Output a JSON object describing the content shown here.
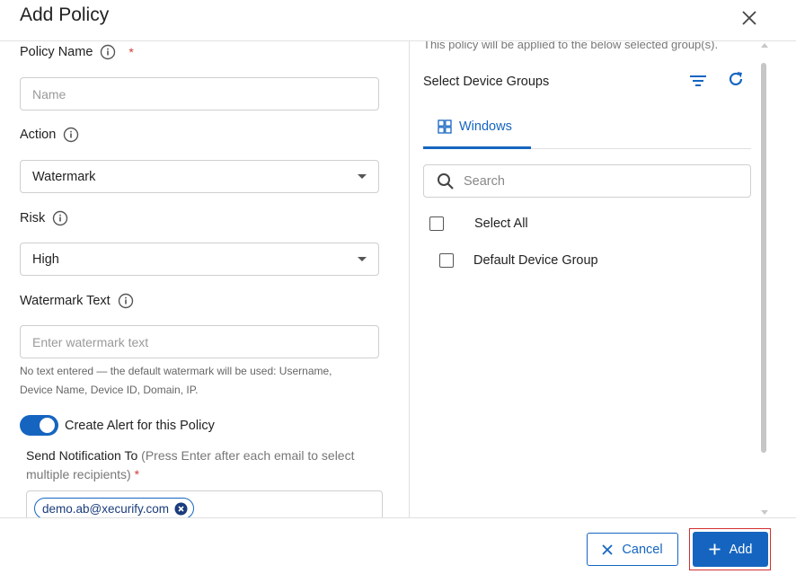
{
  "dialog": {
    "title": "Add Policy"
  },
  "form": {
    "policy_name": {
      "label": "Policy Name",
      "required_mark": "*",
      "placeholder": "Name",
      "value": ""
    },
    "action": {
      "label": "Action",
      "value": "Watermark"
    },
    "risk": {
      "label": "Risk",
      "value": "High"
    },
    "watermark_text": {
      "label": "Watermark Text",
      "placeholder": "Enter watermark text",
      "value": "",
      "helper_line1": "No text entered — the default watermark will be used: Username,",
      "helper_line2": "Device Name, Device ID, Domain, IP."
    },
    "alert_toggle": {
      "label": "Create Alert for this Policy",
      "on": true
    },
    "notification": {
      "label": "Send Notification To",
      "hint": "(Press Enter after each email to select multiple recipients)",
      "required_mark": "*",
      "recipients": [
        "demo.ab@xecurify.com"
      ]
    }
  },
  "groups": {
    "note": "This policy will be applied to the below selected group(s).",
    "title": "Select Device Groups",
    "tabs": [
      {
        "label": "Windows",
        "icon": "windows-icon",
        "active": true
      }
    ],
    "search": {
      "placeholder": "Search",
      "value": ""
    },
    "select_all_label": "Select All",
    "items": [
      {
        "label": "Default Device Group",
        "checked": false
      }
    ]
  },
  "footer": {
    "cancel_label": "Cancel",
    "add_label": "Add"
  },
  "colors": {
    "primary": "#1565c0",
    "required": "#d2403c",
    "highlight_outline": "#d42e2e",
    "border": "#cfcfcf"
  }
}
